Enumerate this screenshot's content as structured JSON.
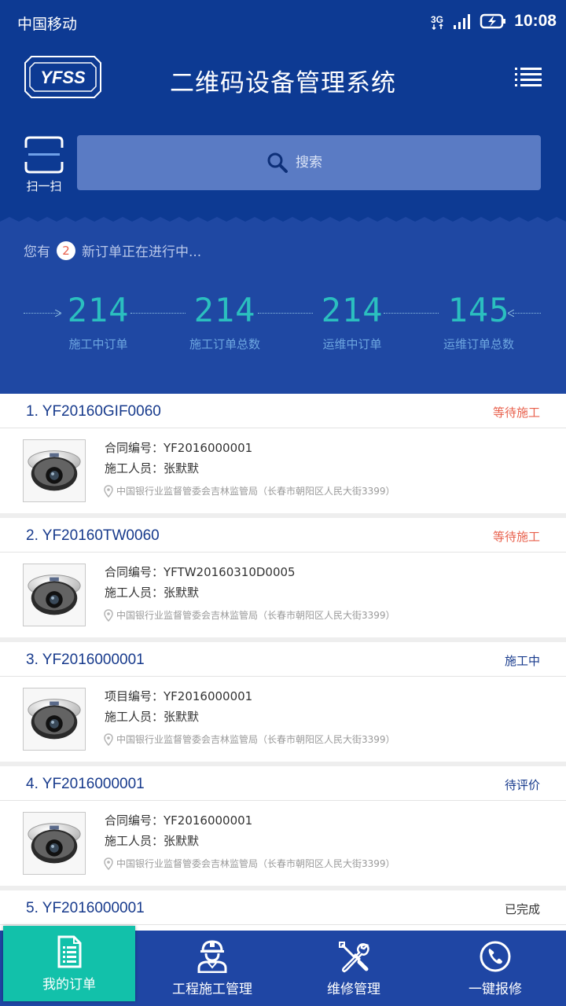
{
  "status_bar": {
    "carrier": "中国移动",
    "time": "10:08"
  },
  "header": {
    "logo_text": "YFSS",
    "title": "二维码设备管理系统"
  },
  "scan": {
    "label": "扫一扫"
  },
  "search": {
    "placeholder": "搜索"
  },
  "notice": {
    "prefix": "您有",
    "count": "2",
    "suffix": "新订单正在进行中..."
  },
  "stats": [
    {
      "value": "214",
      "label": "施工中订单"
    },
    {
      "value": "214",
      "label": "施工订单总数"
    },
    {
      "value": "214",
      "label": "运维中订单"
    },
    {
      "value": "145",
      "label": "运维订单总数"
    }
  ],
  "orders": [
    {
      "number": "1. YF20160GIF0060",
      "status": "等待施工",
      "status_color": "#e8604c",
      "line1": "合同编号：YF2016000001",
      "line2": "施工人员：张默默",
      "address": "中国银行业监督管委会吉林监管局（长春市朝阳区人民大街3399）"
    },
    {
      "number": "2. YF20160TW0060",
      "status": "等待施工",
      "status_color": "#e8604c",
      "line1": "合同编号：YFTW20160310D0005",
      "line2": "施工人员：张默默",
      "address": "中国银行业监督管委会吉林监管局（长春市朝阳区人民大街3399）"
    },
    {
      "number": "3. YF2016000001",
      "status": "施工中",
      "status_color": "#173a8c",
      "line1": "项目编号：YF2016000001",
      "line2": "施工人员：张默默",
      "address": "中国银行业监督管委会吉林监管局（长春市朝阳区人民大街3399）"
    },
    {
      "number": "4. YF2016000001",
      "status": "待评价",
      "status_color": "#173a8c",
      "line1": "合同编号：YF2016000001",
      "line2": "施工人员：张默默",
      "address": "中国银行业监督管委会吉林监管局（长春市朝阳区人民大街3399）"
    },
    {
      "number": "5. YF2016000001",
      "status": "已完成",
      "status_color": "#333333"
    }
  ],
  "tabs": [
    {
      "label": "我的订单",
      "icon": "document-icon",
      "active": true
    },
    {
      "label": "工程施工管理",
      "icon": "worker-icon"
    },
    {
      "label": "维修管理",
      "icon": "tools-icon"
    },
    {
      "label": "一键报修",
      "icon": "phone-icon"
    }
  ],
  "colors": {
    "primary": "#0d3a93",
    "accent": "#12c1aa",
    "stat_number": "#2bbfbf",
    "pending": "#e8604c"
  }
}
